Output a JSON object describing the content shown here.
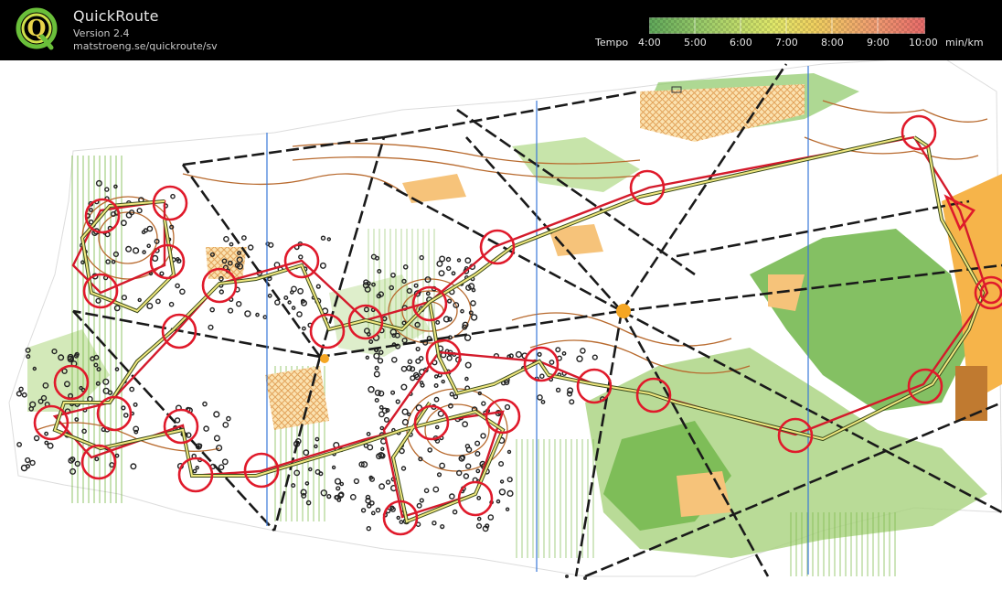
{
  "app": {
    "title": "QuickRoute",
    "version": "Version 2.4",
    "url": "matstroeng.se/quickroute/sv",
    "logo_letter": "Q",
    "logo_icon": "quickroute-logo-icon"
  },
  "legend": {
    "label": "Tempo",
    "ticks": [
      "4:00",
      "5:00",
      "6:00",
      "7:00",
      "8:00",
      "9:00",
      "10:00"
    ],
    "unit": "min/km",
    "gradient_colors": [
      "#5fa85a",
      "#9ccc6a",
      "#e0e86a",
      "#f0d060",
      "#f0a070",
      "#e86a6a"
    ]
  },
  "colors": {
    "header_bg": "#000000",
    "map_white": "#ffffff",
    "forest_green": "#69b043",
    "rough_yellow": "#f5b860",
    "contour_brown": "#b86a2e",
    "control_red": "#e01a2b",
    "route_red": "#c8102e",
    "route_yellow": "#f0e880",
    "magnetic_blue": "#3a78d8"
  },
  "map": {
    "icon": "orienteering-map"
  }
}
